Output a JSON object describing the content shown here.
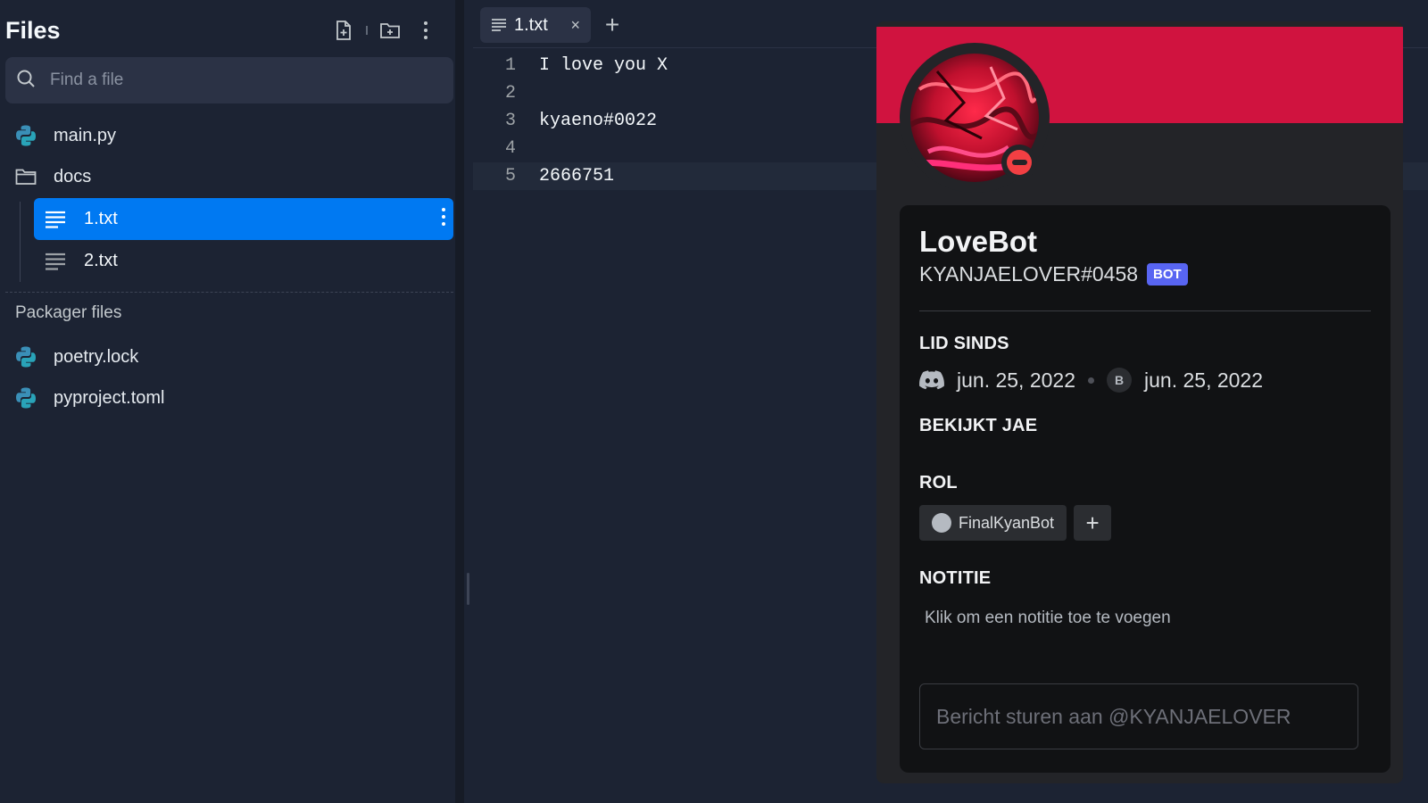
{
  "sidebar": {
    "title": "Files",
    "search_placeholder": "Find a file",
    "tree": [
      {
        "label": "main.py",
        "icon": "python-icon"
      },
      {
        "label": "docs",
        "icon": "folder-icon"
      }
    ],
    "docs_files": [
      {
        "label": "1.txt",
        "icon": "text-file-icon",
        "active": true
      },
      {
        "label": "2.txt",
        "icon": "text-file-icon",
        "active": false
      }
    ],
    "packager_label": "Packager files",
    "packager_files": [
      {
        "label": "poetry.lock",
        "icon": "python-icon"
      },
      {
        "label": "pyproject.toml",
        "icon": "python-icon"
      }
    ]
  },
  "editor": {
    "tab_label": "1.txt",
    "tab_close": "×",
    "add_tab": "+",
    "lines": [
      {
        "n": "1",
        "text": "I love you X"
      },
      {
        "n": "2",
        "text": ""
      },
      {
        "n": "3",
        "text": "kyaeno#0022"
      },
      {
        "n": "4",
        "text": ""
      },
      {
        "n": "5",
        "text": "2666751"
      }
    ]
  },
  "profile": {
    "banner_color": "#d0133f",
    "name": "LoveBot",
    "tag": "KYANJAELOVER#0458",
    "badge": "BOT",
    "member_since_heading": "LID SINDS",
    "discord_date": "jun. 25, 2022",
    "server_initial": "B",
    "server_date": "jun. 25, 2022",
    "watching_heading": "BEKIJKT JAE",
    "role_heading": "ROL",
    "role_name": "FinalKyanBot",
    "role_add": "+",
    "note_heading": "NOTITIE",
    "note_placeholder": "Klik om een notitie toe te voegen",
    "message_placeholder": "Bericht sturen aan @KYANJAELOVER"
  },
  "colors": {
    "accent": "#0079f2",
    "status_dnd": "#f23f43",
    "bot_badge": "#5865f2"
  }
}
